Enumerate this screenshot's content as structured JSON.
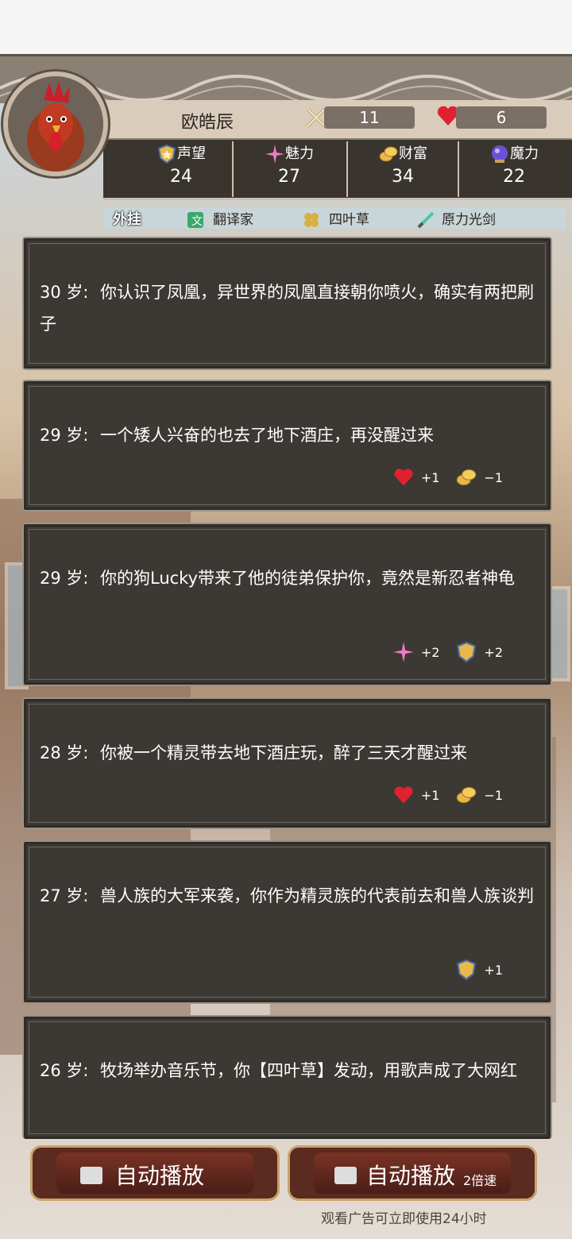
{
  "player": {
    "name": "欧皓辰",
    "attack": "11",
    "hp": "6"
  },
  "attributes": [
    {
      "label": "声望",
      "value": "24",
      "icon": "shield-star-icon"
    },
    {
      "label": "魅力",
      "value": "27",
      "icon": "sparkle-icon"
    },
    {
      "label": "财富",
      "value": "34",
      "icon": "coins-icon"
    },
    {
      "label": "魔力",
      "value": "22",
      "icon": "magic-orb-icon"
    }
  ],
  "cheats": {
    "title": "外挂",
    "items": [
      "翻译家",
      "四叶草",
      "原力光剑"
    ]
  },
  "events": [
    {
      "age": "30 岁:",
      "text": "你认识了凤凰，异世界的凤凰直接朝你喷火，确实有两把刷子",
      "effects": []
    },
    {
      "age": "29 岁:",
      "text": "一个矮人兴奋的也去了地下酒庄，再没醒过来",
      "effects": [
        {
          "icon": "heart-icon",
          "delta": "+1"
        },
        {
          "icon": "coins-icon",
          "delta": "−1"
        }
      ]
    },
    {
      "age": "29 岁:",
      "text": "你的狗Lucky带来了他的徒弟保护你，竟然是新忍者神龟",
      "effects": [
        {
          "icon": "sparkle-icon",
          "delta": "+2"
        },
        {
          "icon": "shield-star-icon",
          "delta": "+2"
        }
      ]
    },
    {
      "age": "28 岁:",
      "text": "你被一个精灵带去地下酒庄玩，醉了三天才醒过来",
      "effects": [
        {
          "icon": "heart-icon",
          "delta": "+1"
        },
        {
          "icon": "coins-icon",
          "delta": "−1"
        }
      ]
    },
    {
      "age": "27 岁:",
      "text": "兽人族的大军来袭，你作为精灵族的代表前去和兽人族谈判",
      "effects": [
        {
          "icon": "shield-star-icon",
          "delta": "+1"
        }
      ]
    },
    {
      "age": "26 岁:",
      "text": "牧场举办音乐节，你【四叶草】发动，用歌声成了大网红",
      "effects": []
    }
  ],
  "buttons": {
    "autoplay": "自动播放",
    "autoplay_fast": "自动播放",
    "speed": "2倍速",
    "ad_note": "观看广告可立即使用24小时"
  },
  "colors": {
    "card_bg": "#3c3833",
    "heart": "#e0222e",
    "gold": "#e8b84a",
    "button": "#5b2a20"
  }
}
